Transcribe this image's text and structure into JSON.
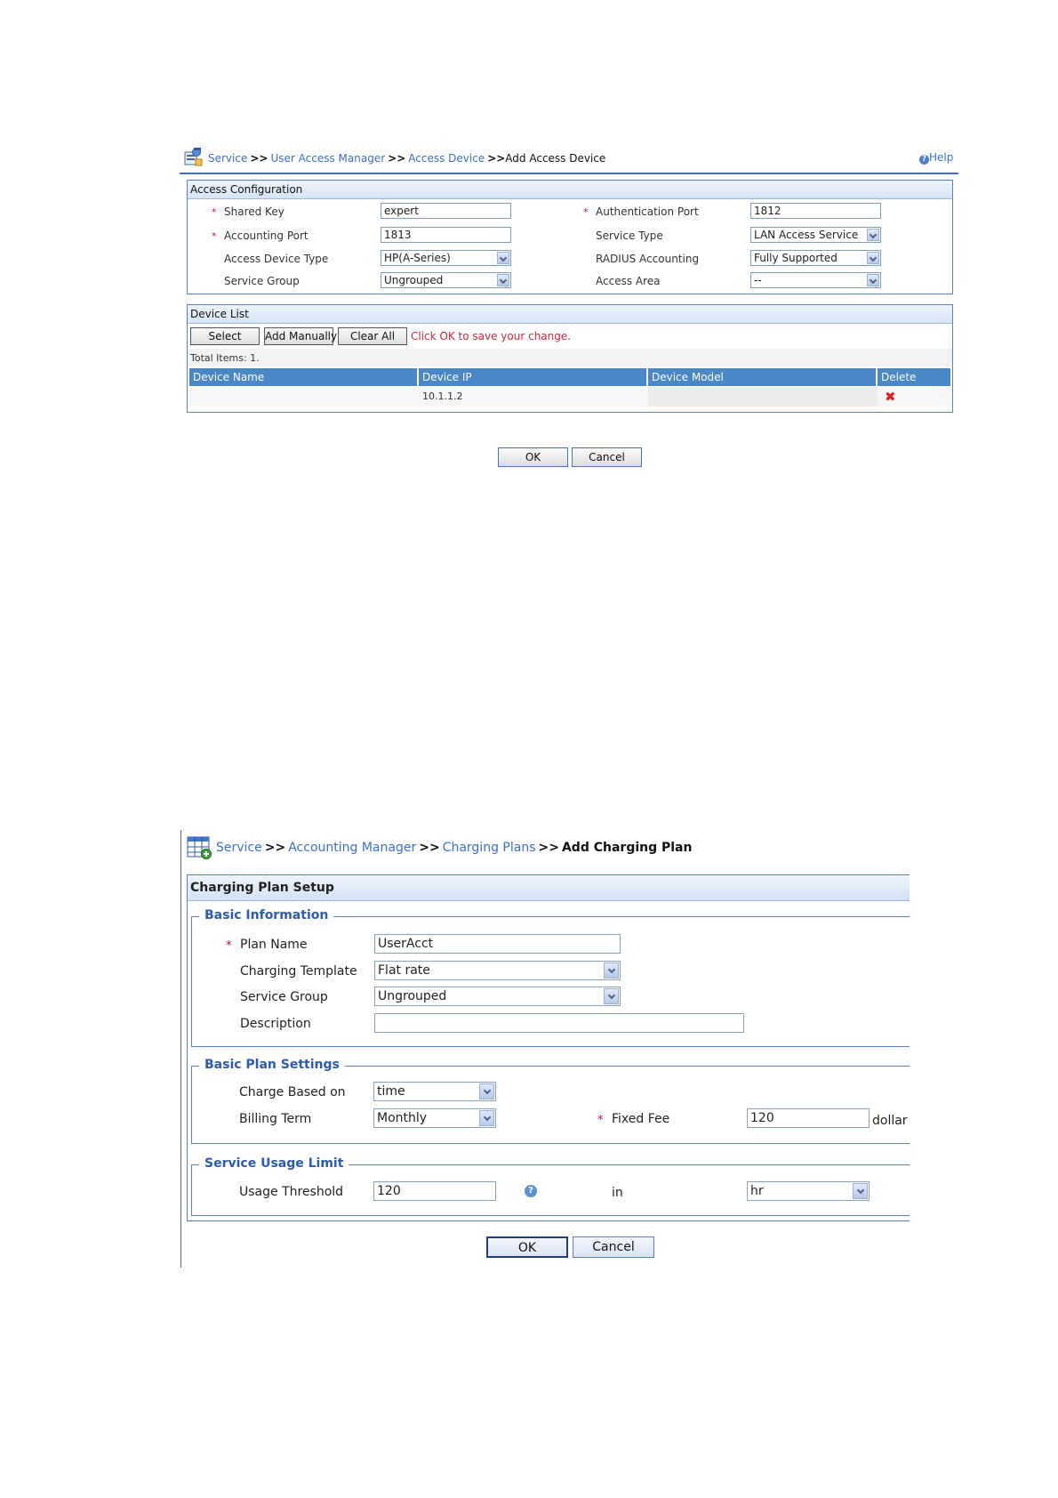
{
  "screen1": {
    "breadcrumb": {
      "items": [
        "Service",
        "User Access Manager",
        "Access Device"
      ],
      "sep": ">>",
      "current": "Add Access Device"
    },
    "help_label": "Help",
    "access_config": {
      "title": "Access Configuration",
      "shared_key_label": "Shared Key",
      "shared_key_value": "expert",
      "auth_port_label": "Authentication Port",
      "auth_port_value": "1812",
      "acct_port_label": "Accounting Port",
      "acct_port_value": "1813",
      "service_type_label": "Service Type",
      "service_type_value": "LAN Access Service",
      "device_type_label": "Access Device Type",
      "device_type_value": "HP(A-Series)",
      "radius_acct_label": "RADIUS Accounting",
      "radius_acct_value": "Fully Supported",
      "service_group_label": "Service Group",
      "service_group_value": "Ungrouped",
      "access_area_label": "Access Area",
      "access_area_value": "--"
    },
    "device_list": {
      "title": "Device List",
      "select_label": "Select",
      "add_manually_label": "Add Manually",
      "clear_all_label": "Clear All",
      "hint": "Click OK to save your change.",
      "total": "Total Items: 1.",
      "columns": [
        "Device Name",
        "Device IP",
        "Device Model",
        "Delete"
      ],
      "rows": [
        {
          "name": "",
          "ip": "10.1.1.2",
          "model": ""
        }
      ]
    },
    "ok_label": "OK",
    "cancel_label": "Cancel"
  },
  "screen2": {
    "breadcrumb": {
      "items": [
        "Service",
        "Accounting Manager",
        "Charging Plans"
      ],
      "sep": ">>",
      "current": "Add Charging Plan"
    },
    "panel_title": "Charging Plan Setup",
    "basic_info": {
      "title": "Basic Information",
      "plan_name_label": "Plan Name",
      "plan_name_value": "UserAcct",
      "template_label": "Charging Template",
      "template_value": "Flat rate",
      "service_group_label": "Service Group",
      "service_group_value": "Ungrouped",
      "description_label": "Description",
      "description_value": ""
    },
    "basic_plan": {
      "title": "Basic Plan Settings",
      "charge_based_label": "Charge Based on",
      "charge_based_value": "time",
      "billing_term_label": "Billing Term",
      "billing_term_value": "Monthly",
      "fixed_fee_label": "Fixed Fee",
      "fixed_fee_value": "120",
      "fixed_fee_unit": "dollar"
    },
    "usage_limit": {
      "title": "Service Usage Limit",
      "threshold_label": "Usage Threshold",
      "threshold_value": "120",
      "in_label": "in",
      "unit_value": "hr"
    },
    "ok_label": "OK",
    "cancel_label": "Cancel"
  },
  "colors": {
    "link": "#3a6fd0",
    "table_header": "#4a87c6",
    "required": "#c8102e",
    "hint": "#d0263a"
  },
  "icons": [
    "service-module-icon",
    "help-icon",
    "delete-icon",
    "accounting-grid-icon",
    "info-icon"
  ]
}
